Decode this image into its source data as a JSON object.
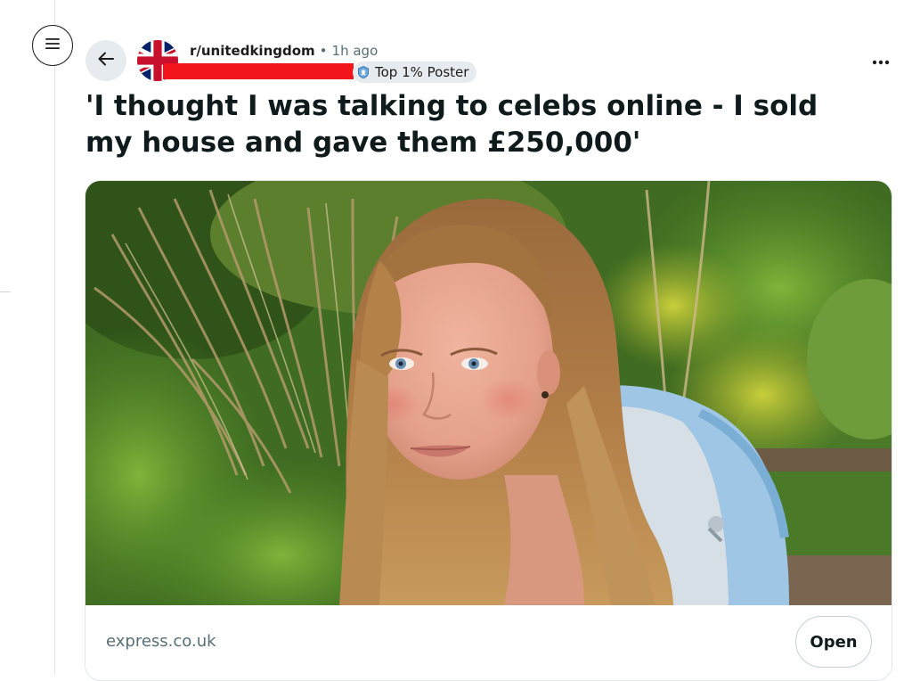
{
  "post": {
    "subreddit": "r/unitedkingdom",
    "separator": "•",
    "time_ago": "1h ago",
    "flair": "Top 1% Poster",
    "title": "'I thought I was talking to celebs online - I sold my house and gave them £250,000'"
  },
  "link_card": {
    "domain": "express.co.uk",
    "open_label": "Open"
  },
  "icons": {
    "menu": "hamburger-icon",
    "back": "arrow-left-icon",
    "subreddit_avatar": "union-jack-icon",
    "flair": "top-poster-badge-icon",
    "more": "more-horizontal-icon"
  },
  "colors": {
    "redaction": "#f2161c",
    "chip_bg": "#e5ebee",
    "meta_text": "#576f76"
  }
}
